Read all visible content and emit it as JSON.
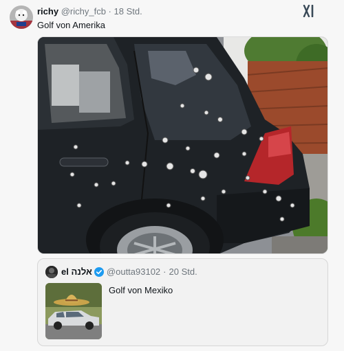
{
  "post": {
    "name": "richy",
    "handle": "@richy_fcb",
    "separator": "·",
    "time": "18 Std.",
    "text": "Golf von Amerika"
  },
  "quoted": {
    "name_latin": "el",
    "name_hebrew": "אלנה",
    "handle": "@outta93102",
    "separator": "·",
    "time": "20 Std.",
    "text": "Golf von Mexiko"
  },
  "icons": {
    "brand": "x-logo-icon",
    "verified": "verified-badge-icon",
    "verified_color": "#1d9bf0"
  }
}
